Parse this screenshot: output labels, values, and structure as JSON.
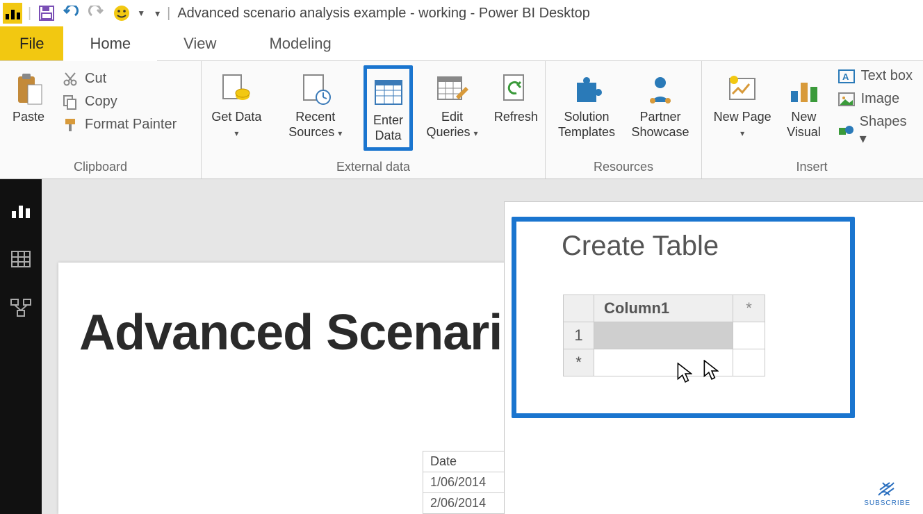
{
  "titlebar": {
    "app_title": "Advanced scenario analysis example - working - Power BI Desktop"
  },
  "tabs": {
    "file": "File",
    "home": "Home",
    "view": "View",
    "modeling": "Modeling"
  },
  "ribbon": {
    "clipboard": {
      "label": "Clipboard",
      "paste": "Paste",
      "cut": "Cut",
      "copy": "Copy",
      "format_painter": "Format Painter"
    },
    "external_data": {
      "label": "External data",
      "get_data": "Get Data",
      "recent_sources": "Recent Sources",
      "enter_data": "Enter Data",
      "edit_queries": "Edit Queries",
      "refresh": "Refresh"
    },
    "resources": {
      "label": "Resources",
      "solution_templates": "Solution Templates",
      "partner_showcase": "Partner Showcase"
    },
    "insert": {
      "label": "Insert",
      "new_page": "New Page",
      "new_visual": "New Visual",
      "text_box": "Text box",
      "image": "Image",
      "shapes": "Shapes"
    }
  },
  "report": {
    "title": "Advanced Scenario",
    "date_header": "Date",
    "dates": [
      "1/06/2014",
      "2/06/2014"
    ]
  },
  "dialog": {
    "title": "Create Table",
    "column1": "Column1",
    "row1": "1",
    "asterisk": "*"
  },
  "subscribe": "SUBSCRIBE"
}
